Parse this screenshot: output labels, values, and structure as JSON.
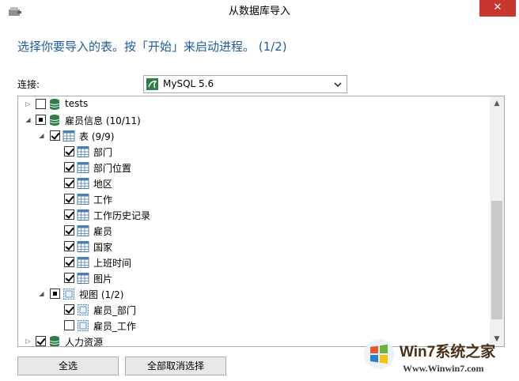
{
  "window": {
    "title": "从数据库导入",
    "close_glyph": "✕"
  },
  "instruction": "选择你要导入的表。按「开始」来启动进程。 (1/2)",
  "connection": {
    "label": "连接:",
    "value": "MySQL 5.6"
  },
  "tree": {
    "rows": [
      {
        "label": "tests",
        "expanded": false,
        "state": "unchecked",
        "icon": "database-icon"
      },
      {
        "label": "雇员信息 (10/11)",
        "expanded": true,
        "state": "partial",
        "icon": "database-icon"
      },
      {
        "label": "表 (9/9)",
        "expanded": true,
        "state": "checked",
        "icon": "table-folder-icon"
      },
      {
        "label": "部门",
        "state": "checked",
        "icon": "table-icon"
      },
      {
        "label": "部门位置",
        "state": "checked",
        "icon": "table-icon"
      },
      {
        "label": "地区",
        "state": "checked",
        "icon": "table-icon"
      },
      {
        "label": "工作",
        "state": "checked",
        "icon": "table-icon"
      },
      {
        "label": "工作历史记录",
        "state": "checked",
        "icon": "table-icon"
      },
      {
        "label": "雇员",
        "state": "checked",
        "icon": "table-icon"
      },
      {
        "label": "国家",
        "state": "checked",
        "icon": "table-icon"
      },
      {
        "label": "上班时间",
        "state": "checked",
        "icon": "table-icon"
      },
      {
        "label": "图片",
        "state": "checked",
        "icon": "table-icon"
      },
      {
        "label": "视图 (1/2)",
        "expanded": true,
        "state": "partial",
        "icon": "view-folder-icon"
      },
      {
        "label": "雇员_部门",
        "state": "checked",
        "icon": "view-icon"
      },
      {
        "label": "雇员_工作",
        "state": "unchecked",
        "icon": "view-icon"
      },
      {
        "label": "人力资源",
        "expanded": false,
        "state": "checked",
        "icon": "database-icon"
      }
    ]
  },
  "buttons": {
    "select_all": "全选",
    "deselect_all": "全部取消选择"
  },
  "watermark": {
    "title": "Win7系统之家",
    "url": "Www.Winwin7.com"
  },
  "colors": {
    "instruction": "#1e5b9e",
    "close_button": "#c7372f",
    "database": "#2d7f47",
    "table_icon": "#4a7fb5"
  }
}
